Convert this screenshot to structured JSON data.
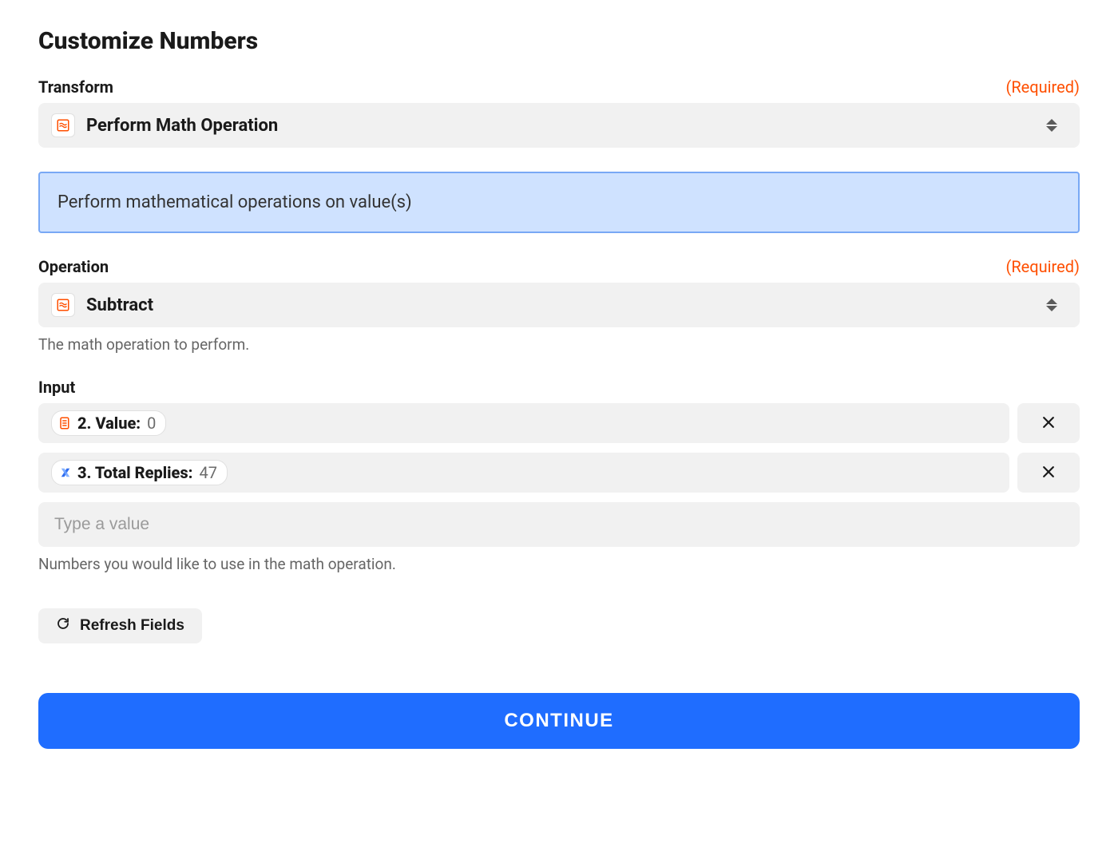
{
  "page": {
    "title": "Customize Numbers"
  },
  "transform": {
    "label": "Transform",
    "required_label": "(Required)",
    "selected": "Perform Math Operation",
    "info_banner": "Perform mathematical operations on value(s)"
  },
  "operation": {
    "label": "Operation",
    "required_label": "(Required)",
    "selected": "Subtract",
    "helper": "The math operation to perform."
  },
  "input": {
    "label": "Input",
    "items": [
      {
        "icon": "storage",
        "label": "2. Value:",
        "value": "0"
      },
      {
        "icon": "helpscout",
        "label": "3. Total Replies:",
        "value": "47"
      }
    ],
    "placeholder": "Type a value",
    "helper": "Numbers you would like to use in the math operation."
  },
  "actions": {
    "refresh_label": "Refresh Fields",
    "continue_label": "CONTINUE"
  }
}
